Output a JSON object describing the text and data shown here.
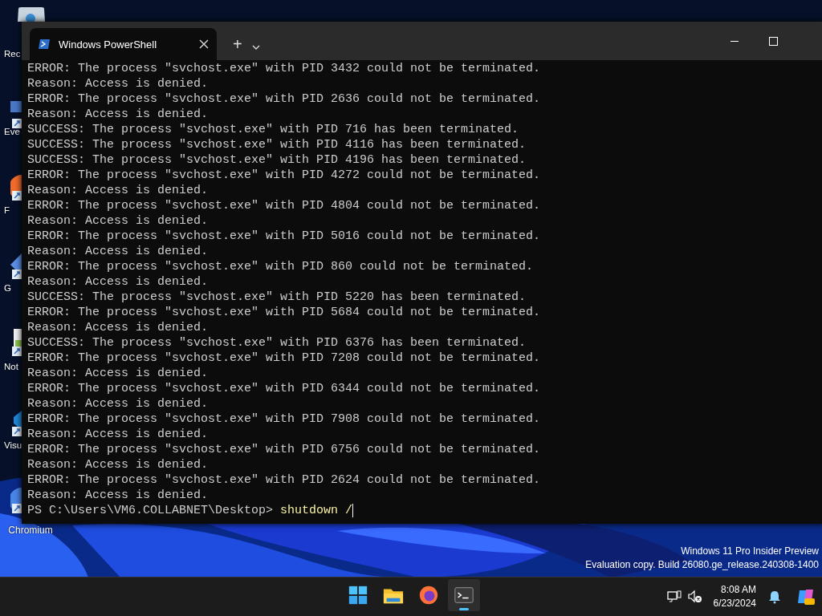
{
  "desktop_icons": [
    {
      "kind": "recycle-bin",
      "label": "Rec",
      "cut_off": true
    },
    {
      "kind": "app",
      "label": "Eve",
      "cut_off": true
    },
    {
      "kind": "round-app",
      "label": "F",
      "cut_off": true
    },
    {
      "kind": "diamond-app",
      "label": "G",
      "cut_off": true
    },
    {
      "kind": "notepad",
      "label": "Not",
      "cut_off": true
    },
    {
      "kind": "code-app",
      "label": "Visu",
      "cut_off": true
    },
    {
      "kind": "browser",
      "label": "Chromium",
      "cut_off": false
    }
  ],
  "window": {
    "tabs": [
      {
        "title": "Windows PowerShell",
        "selected": true
      }
    ],
    "new_tab": "+"
  },
  "terminal": {
    "lines": [
      "ERROR: The process \"svchost.exe\" with PID 3432 could not be terminated.",
      "Reason: Access is denied.",
      "ERROR: The process \"svchost.exe\" with PID 2636 could not be terminated.",
      "Reason: Access is denied.",
      "SUCCESS: The process \"svchost.exe\" with PID 716 has been terminated.",
      "SUCCESS: The process \"svchost.exe\" with PID 4116 has been terminated.",
      "SUCCESS: The process \"svchost.exe\" with PID 4196 has been terminated.",
      "ERROR: The process \"svchost.exe\" with PID 4272 could not be terminated.",
      "Reason: Access is denied.",
      "ERROR: The process \"svchost.exe\" with PID 4804 could not be terminated.",
      "Reason: Access is denied.",
      "ERROR: The process \"svchost.exe\" with PID 5016 could not be terminated.",
      "Reason: Access is denied.",
      "ERROR: The process \"svchost.exe\" with PID 860 could not be terminated.",
      "Reason: Access is denied.",
      "SUCCESS: The process \"svchost.exe\" with PID 5220 has been terminated.",
      "ERROR: The process \"svchost.exe\" with PID 5684 could not be terminated.",
      "Reason: Access is denied.",
      "SUCCESS: The process \"svchost.exe\" with PID 6376 has been terminated.",
      "ERROR: The process \"svchost.exe\" with PID 7208 could not be terminated.",
      "Reason: Access is denied.",
      "ERROR: The process \"svchost.exe\" with PID 6344 could not be terminated.",
      "Reason: Access is denied.",
      "ERROR: The process \"svchost.exe\" with PID 7908 could not be terminated.",
      "Reason: Access is denied.",
      "ERROR: The process \"svchost.exe\" with PID 6756 could not be terminated.",
      "Reason: Access is denied.",
      "ERROR: The process \"svchost.exe\" with PID 2624 could not be terminated.",
      "Reason: Access is denied."
    ],
    "prompt": "PS C:\\Users\\VM6.COLLABNET\\Desktop>",
    "command": "shutdown /"
  },
  "watermark": [
    "Windows 11 Pro Insider Preview",
    "Evaluation copy. Build 26080.ge_release.240308-1400"
  ],
  "taskbar": {
    "apps": [
      {
        "kind": "start",
        "selected": false
      },
      {
        "kind": "folder",
        "selected": false
      },
      {
        "kind": "firefox",
        "selected": false
      },
      {
        "kind": "terminal",
        "selected": true
      }
    ],
    "time": "8:08 AM",
    "date": "6/23/2024"
  }
}
